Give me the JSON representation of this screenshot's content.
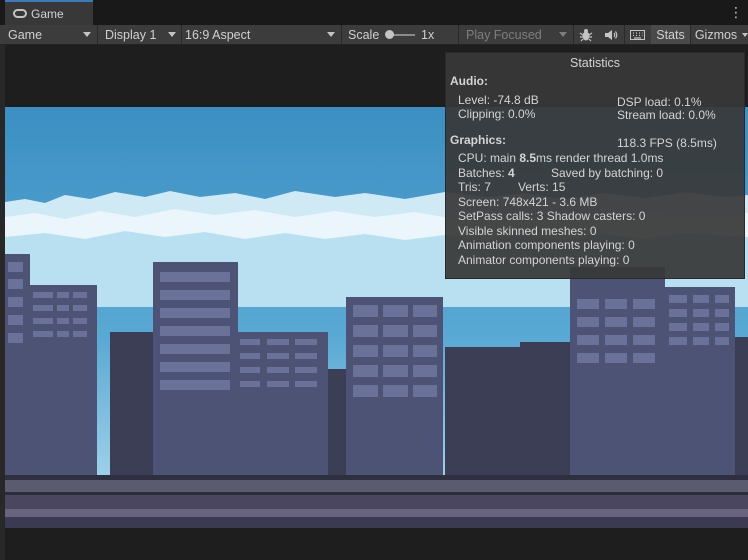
{
  "tab": {
    "label": "Game",
    "icon": "gamepad-icon"
  },
  "toolbar": {
    "view_mode": "Game",
    "display": "Display 1",
    "aspect": "16:9 Aspect",
    "scale_label": "Scale",
    "scale_value": "1x",
    "play_mode": "Play Focused",
    "stats_label": "Stats",
    "gizmos_label": "Gizmos"
  },
  "stats": {
    "title": "Statistics",
    "audio_header": "Audio:",
    "level": "Level: -74.8 dB",
    "dsp_load": "DSP load: 0.1%",
    "clipping": "Clipping: 0.0%",
    "stream_load": "Stream load: 0.0%",
    "graphics_header": "Graphics:",
    "fps": "118.3 FPS (8.5ms)",
    "cpu_prefix": "CPU: main ",
    "cpu_main": "8.5",
    "cpu_suffix": "ms  render thread 1.0ms",
    "batches_prefix": "Batches: ",
    "batches_value": "4",
    "saved_batching": "Saved by batching: 0",
    "tris": "Tris: 7",
    "verts": "Verts: 15",
    "screen": "Screen: 748x421 - 3.6 MB",
    "setpass": "SetPass calls: 3 Shadow casters: 0",
    "skinned": "Visible skinned meshes: 0",
    "animation": "Animation components playing: 0",
    "animator": "Animator components playing: 0"
  },
  "colors": {
    "sky_top": "#3b8fc2",
    "sky_bottom": "#b7dff0",
    "building": "#4c5374",
    "building_dark": "#3b3e55",
    "window": "#6b7299",
    "street": "#3c3a52"
  }
}
